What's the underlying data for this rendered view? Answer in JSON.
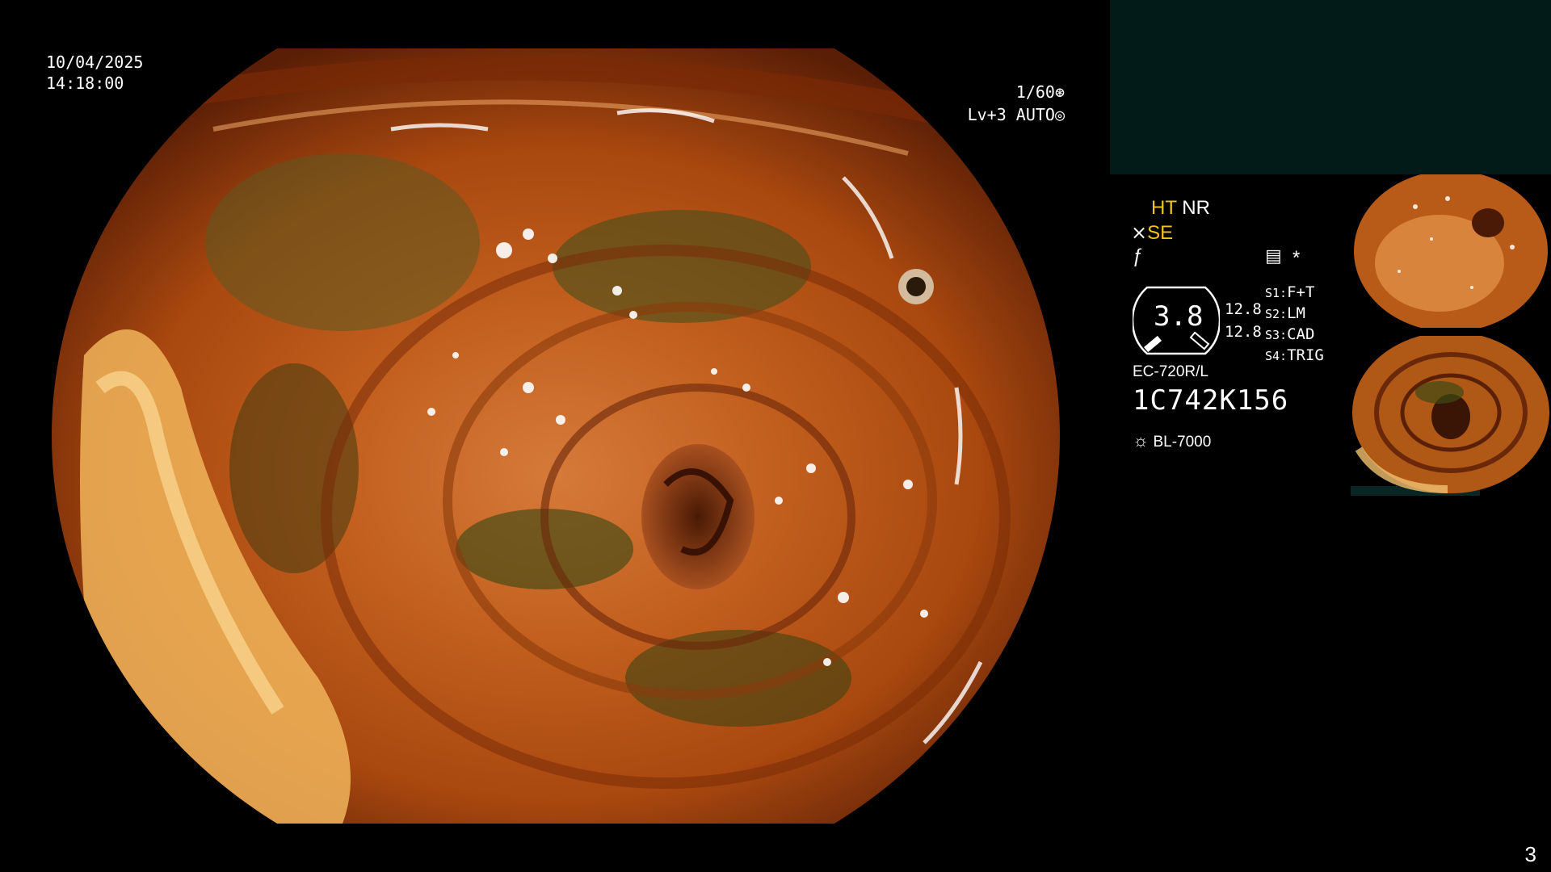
{
  "overlay": {
    "date": "10/04/2025",
    "time": "14:18:00",
    "shutter": "1/60",
    "level": "Lv+3 AUTO"
  },
  "modes": {
    "ht": "HT",
    "nr": "NR",
    "se": "SE",
    "asterisk": "*"
  },
  "gauge": {
    "value": "3.8",
    "left_val_1": "12.8",
    "left_val_2": "12.8"
  },
  "scope_settings": [
    {
      "key": "S1:",
      "value": "F+T"
    },
    {
      "key": "S2:",
      "value": "LM"
    },
    {
      "key": "S3:",
      "value": "CAD"
    },
    {
      "key": "S4:",
      "value": "TRIG"
    }
  ],
  "device": {
    "model": "EC-720R/L",
    "serial": "1C742K156",
    "light_source": "BL-7000"
  },
  "page_number": "3",
  "colors": {
    "panel": "#021a18",
    "accent_yellow": "#f3c31a",
    "tissue_orange": "#c8641e",
    "tissue_dark": "#6a2a08"
  },
  "icons": [
    "shutter-icon",
    "auto-iris-icon",
    "structure-icon",
    "filter-icon",
    "record-icon",
    "lamp-icon"
  ]
}
